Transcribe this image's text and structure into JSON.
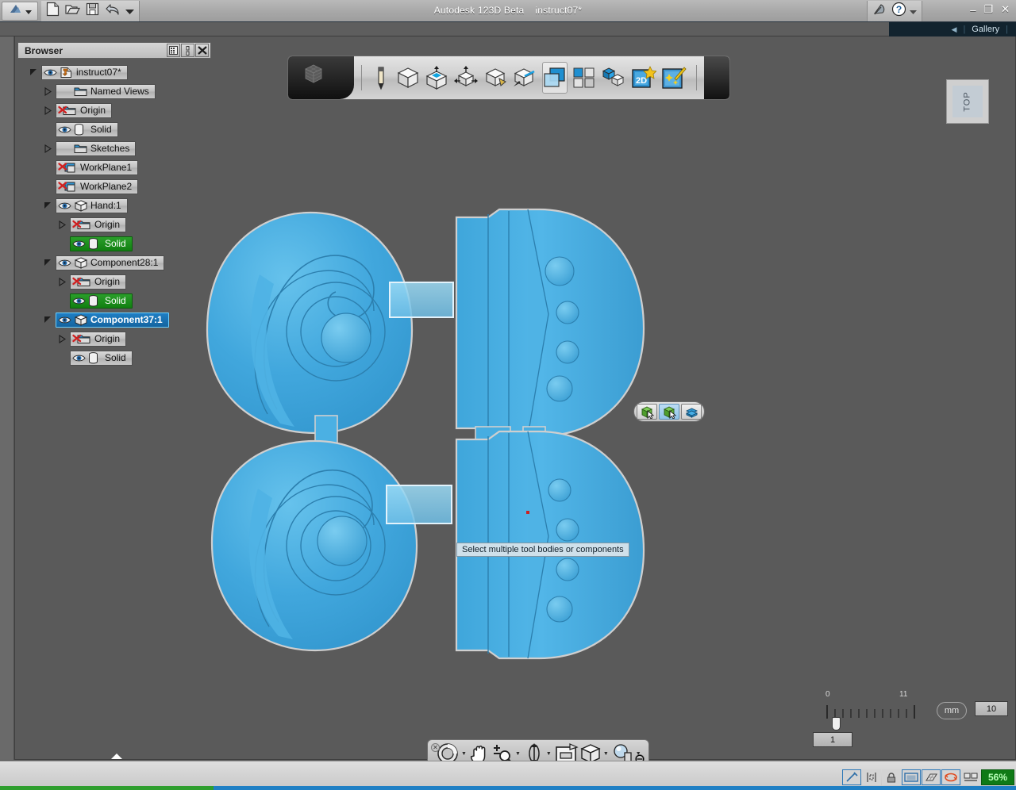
{
  "window": {
    "app_title": "Autodesk 123D Beta",
    "document_title": "instruct07*",
    "minimize": "–",
    "restore": "❐",
    "close": "✕"
  },
  "quick_access": {
    "items": [
      {
        "name": "new-file-icon",
        "label": "New"
      },
      {
        "name": "open-file-icon",
        "label": "Open"
      },
      {
        "name": "save-icon",
        "label": "Save"
      },
      {
        "name": "undo-icon",
        "label": "Undo"
      },
      {
        "name": "customize-qat-icon",
        "label": "Customize"
      }
    ]
  },
  "gallery_bar": {
    "collapse_arrow": "◀",
    "separator": "|",
    "label": "Gallery",
    "trailing_separator": "|"
  },
  "browser": {
    "title": "Browser",
    "buttons": [
      {
        "name": "browser-grid-button",
        "glyph": "▒"
      },
      {
        "name": "browser-options-button",
        "glyph": "⋮"
      },
      {
        "name": "browser-close-button",
        "glyph": "✖"
      }
    ],
    "tree": [
      {
        "label": "instruct07*",
        "depth": 0,
        "twisty": "expanded",
        "icon": "document-pin-icon",
        "eye": true,
        "style": "normal"
      },
      {
        "label": "Named Views",
        "depth": 1,
        "twisty": "collapsed",
        "icon": "folder-icon",
        "eye": false,
        "style": "normal"
      },
      {
        "label": "Origin",
        "depth": 1,
        "twisty": "collapsed",
        "icon": "folder-hidden-icon",
        "eye": false,
        "style": "normal"
      },
      {
        "label": "Solid",
        "depth": 1,
        "twisty": "none",
        "icon": "solid-icon",
        "eye": true,
        "style": "normal"
      },
      {
        "label": "Sketches",
        "depth": 1,
        "twisty": "collapsed",
        "icon": "folder-icon",
        "eye": false,
        "style": "normal"
      },
      {
        "label": "WorkPlane1",
        "depth": 1,
        "twisty": "none",
        "icon": "workplane-hidden-icon",
        "eye": false,
        "style": "normal"
      },
      {
        "label": "WorkPlane2",
        "depth": 1,
        "twisty": "none",
        "icon": "workplane-hidden-icon",
        "eye": false,
        "style": "normal"
      },
      {
        "label": "Hand:1",
        "depth": 1,
        "twisty": "expanded",
        "icon": "component-icon",
        "eye": true,
        "style": "normal"
      },
      {
        "label": "Origin",
        "depth": 2,
        "twisty": "collapsed",
        "icon": "folder-hidden-icon",
        "eye": false,
        "style": "normal"
      },
      {
        "label": "Solid",
        "depth": 2,
        "twisty": "none",
        "icon": "solid-icon",
        "eye": true,
        "style": "green"
      },
      {
        "label": "Component28:1",
        "depth": 1,
        "twisty": "expanded",
        "icon": "component-icon",
        "eye": true,
        "style": "normal"
      },
      {
        "label": "Origin",
        "depth": 2,
        "twisty": "collapsed",
        "icon": "folder-hidden-icon",
        "eye": false,
        "style": "normal"
      },
      {
        "label": "Solid",
        "depth": 2,
        "twisty": "none",
        "icon": "solid-icon",
        "eye": true,
        "style": "green"
      },
      {
        "label": "Component37:1",
        "depth": 1,
        "twisty": "expanded",
        "icon": "component-icon",
        "eye": true,
        "style": "selected"
      },
      {
        "label": "Origin",
        "depth": 2,
        "twisty": "collapsed",
        "icon": "folder-hidden-icon",
        "eye": false,
        "style": "normal"
      },
      {
        "label": "Solid",
        "depth": 2,
        "twisty": "none",
        "icon": "solid-icon",
        "eye": true,
        "style": "normal"
      }
    ]
  },
  "ribbon": {
    "home_icon": "cube-grid-icon",
    "tools": [
      {
        "name": "sketch-pencil-icon",
        "label": "Sketch",
        "active": false
      },
      {
        "name": "primitive-cube-icon",
        "label": "Primitives",
        "active": false
      },
      {
        "name": "extrude-icon",
        "label": "Construct",
        "active": false
      },
      {
        "name": "modify-move-icon",
        "label": "Modify",
        "active": false
      },
      {
        "name": "pattern-icon",
        "label": "Pattern",
        "active": false
      },
      {
        "name": "measure-icon",
        "label": "Measure",
        "active": false
      },
      {
        "name": "combine-icon",
        "label": "Combine",
        "active": true
      },
      {
        "name": "grid-snap-icon",
        "label": "Grid",
        "active": false
      },
      {
        "name": "assemble-icon",
        "label": "Assemble",
        "active": false
      },
      {
        "name": "2d-drawing-icon",
        "label": "2D Drawing",
        "active": false
      },
      {
        "name": "smart-effects-icon",
        "label": "Effects",
        "active": false
      }
    ]
  },
  "view_cube": {
    "label": "TOP"
  },
  "mini_toolbar": {
    "buttons": [
      {
        "name": "select-target-body-icon",
        "label": "Select target body",
        "active": false
      },
      {
        "name": "select-tool-bodies-icon",
        "label": "Select multiple tool bodies or components",
        "active": true
      },
      {
        "name": "combine-result-icon",
        "label": "Combine result",
        "active": false
      }
    ]
  },
  "tooltip": {
    "text": "Select multiple tool bodies or components"
  },
  "scale": {
    "tick_start": "0",
    "tick_end": "11",
    "unit": "mm",
    "zoom_value": "10",
    "step_value": "1"
  },
  "nav_toolbar": {
    "close_glyph": "✕",
    "minimize_glyph": "⊖",
    "buttons": [
      {
        "name": "steering-wheel-icon",
        "label": "SteeringWheels",
        "caret": true
      },
      {
        "name": "pan-hand-icon",
        "label": "Pan",
        "caret": false
      },
      {
        "name": "zoom-icon",
        "label": "Zoom",
        "caret": true
      },
      {
        "name": "orbit-icon",
        "label": "Orbit",
        "caret": true
      },
      {
        "name": "fit-view-icon",
        "label": "Zoom Extents",
        "caret": false
      },
      {
        "name": "view-cube-icon",
        "label": "View",
        "caret": true
      },
      {
        "name": "look-around-icon",
        "label": "Look",
        "caret": true
      }
    ]
  },
  "status_bar": {
    "icons": [
      {
        "name": "snap-icon",
        "framed": true
      },
      {
        "name": "constraints-icon",
        "framed": false
      },
      {
        "name": "lock-icon",
        "framed": false
      },
      {
        "name": "workplane-icon",
        "framed": true
      },
      {
        "name": "grid-icon",
        "framed": true
      },
      {
        "name": "orbit-status-icon",
        "framed": true
      },
      {
        "name": "display-mode-icon",
        "framed": false
      }
    ],
    "zoom_percent": "56%"
  },
  "colors": {
    "body_blue": "#3fa3d8",
    "body_blue_light": "#55b6e6",
    "selection_cyan": "#6fd0ff",
    "green_chip": "#1f8f1f",
    "viewport_bg": "#5a5a5a",
    "status_green": "#0f7a16"
  }
}
